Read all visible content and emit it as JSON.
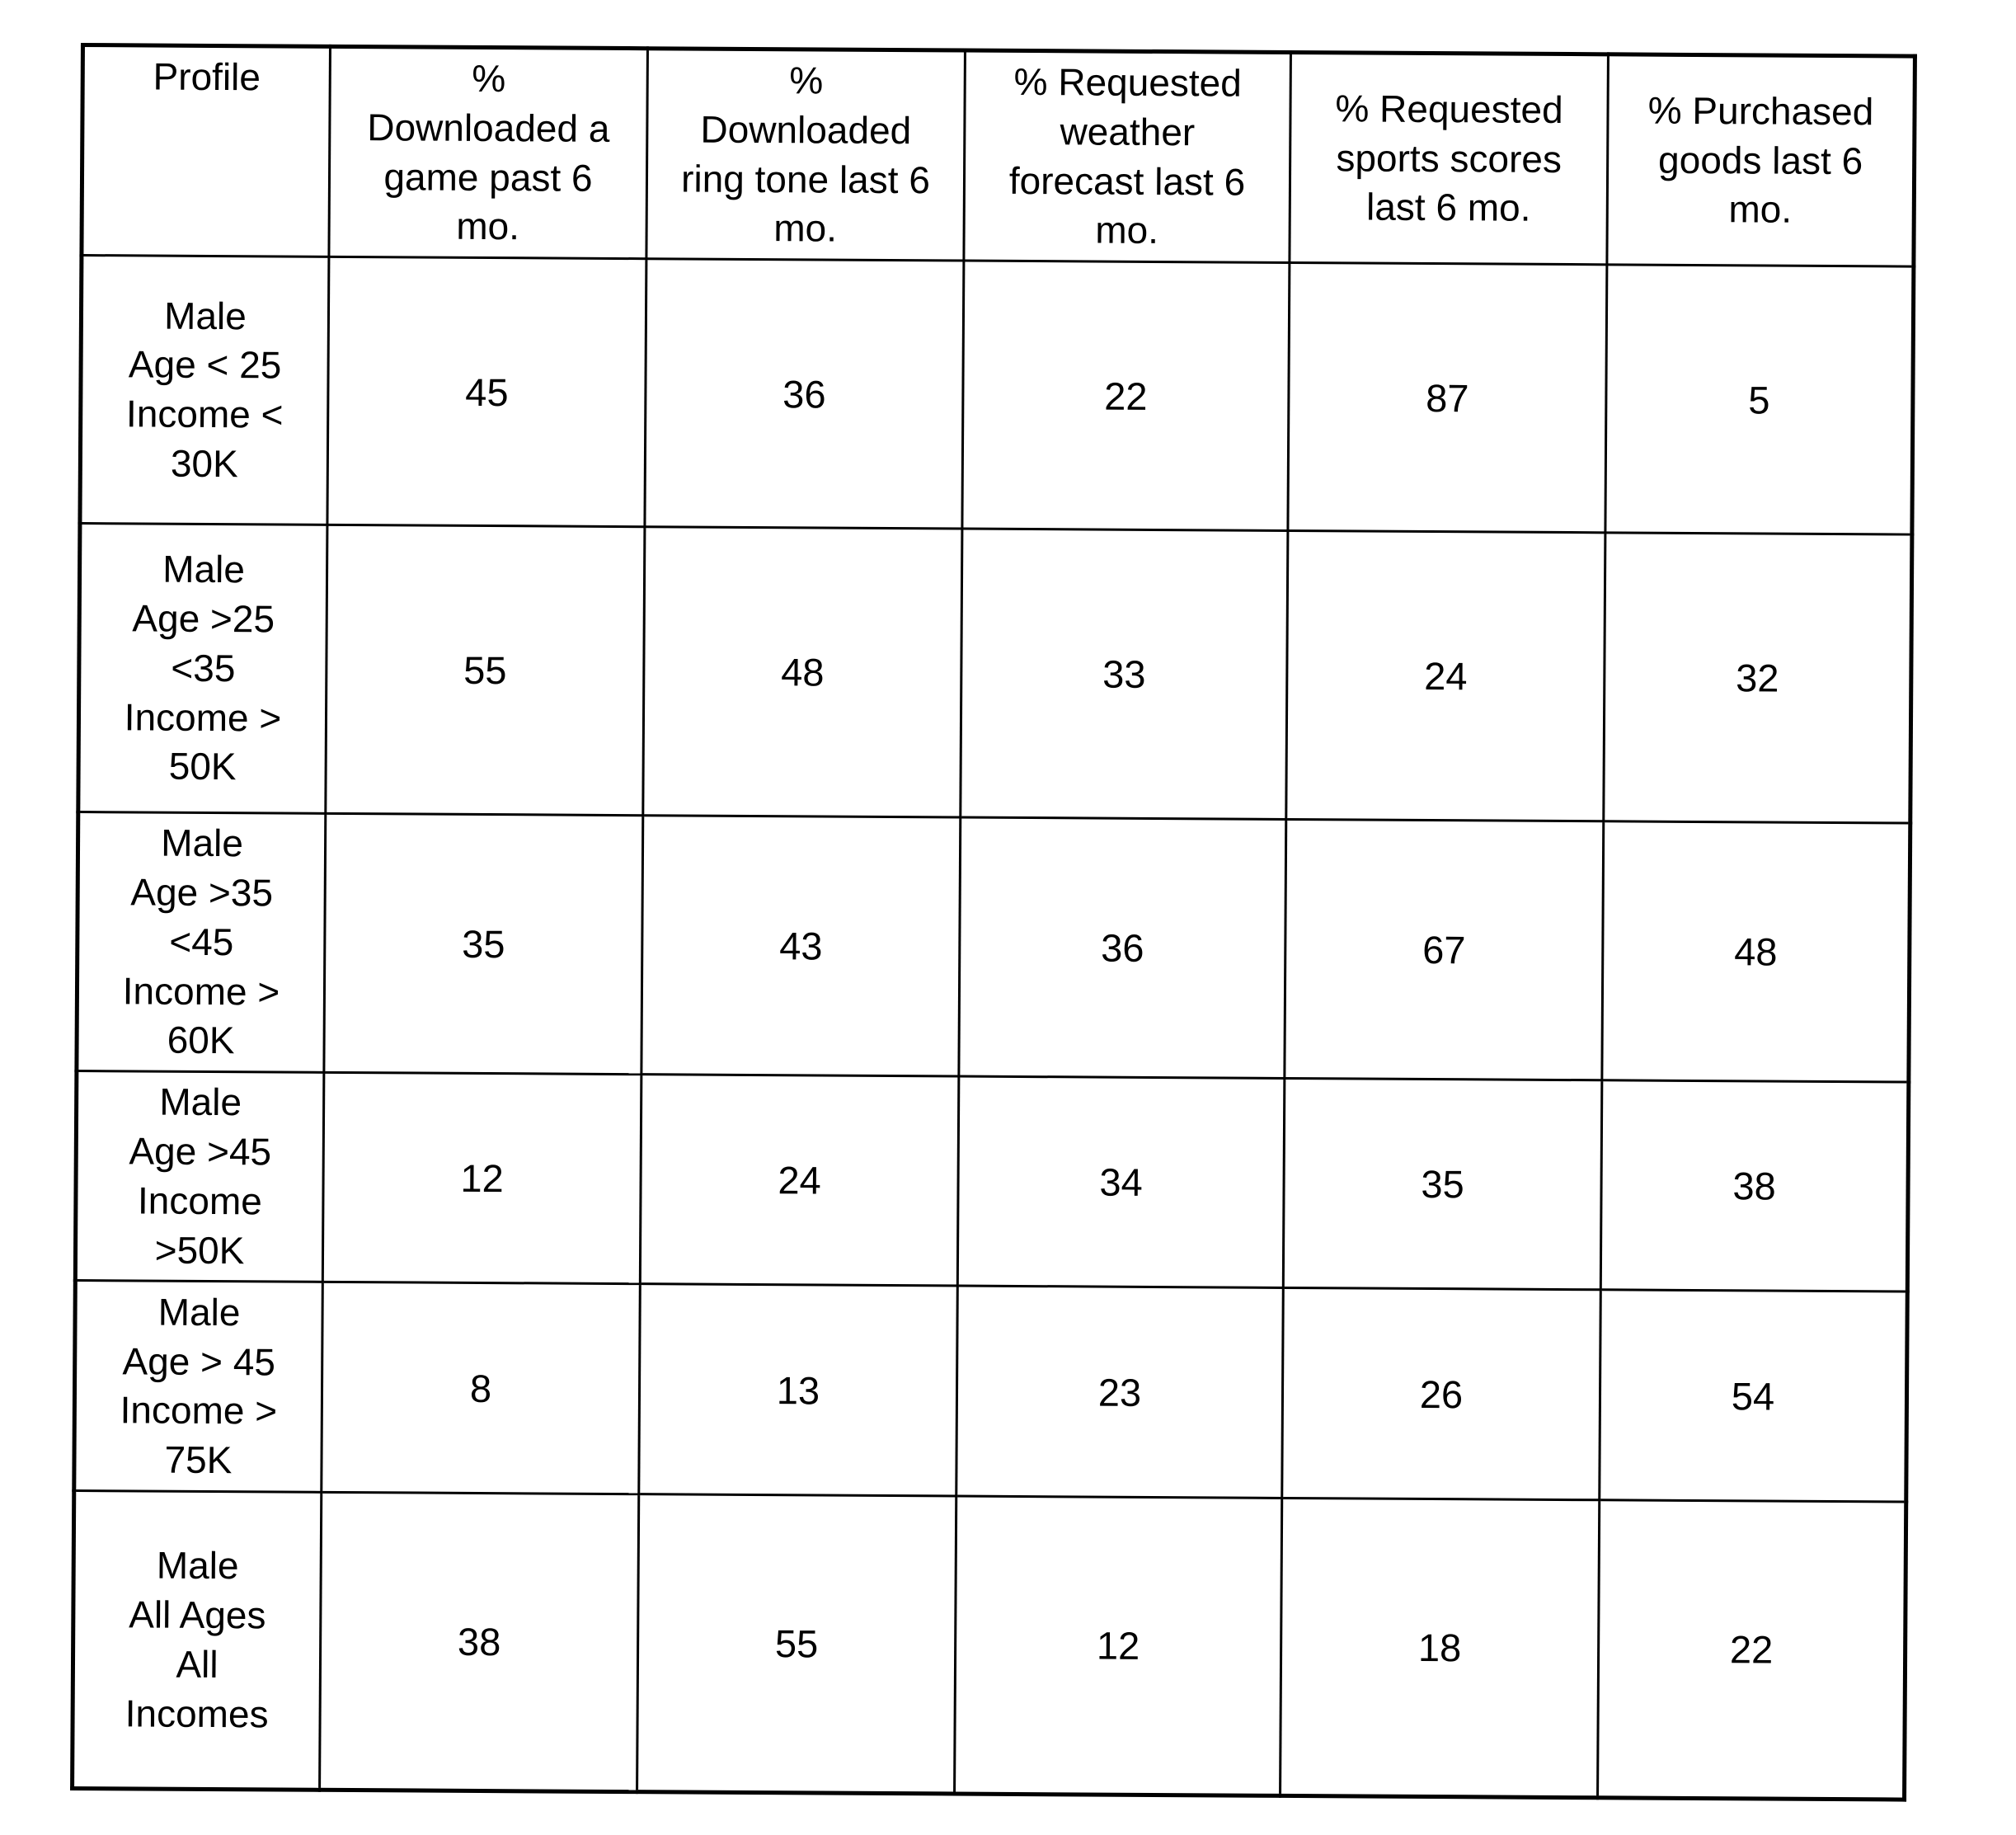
{
  "document": {
    "type": "scanned-table",
    "page_background": "#ffffff",
    "ink_color": "#000000"
  },
  "table": {
    "columns": [
      {
        "key": "profile",
        "label_lines": [
          "Profile"
        ]
      },
      {
        "key": "games",
        "label_lines": [
          "%",
          "Downloaded a",
          "game past 6",
          "mo."
        ]
      },
      {
        "key": "ringtone",
        "label_lines": [
          "%",
          "Downloaded",
          "ring tone last 6",
          "mo."
        ]
      },
      {
        "key": "weather",
        "label_lines": [
          "% Requested",
          "weather",
          "forecast last 6",
          "mo."
        ]
      },
      {
        "key": "sports",
        "label_lines": [
          "% Requested",
          "sports scores",
          "last 6 mo."
        ]
      },
      {
        "key": "goods",
        "label_lines": [
          "% Purchased",
          "goods last 6",
          "mo."
        ]
      }
    ],
    "rows": [
      {
        "profile_lines": [
          "Male",
          "Age < 25",
          "Income <",
          "30K"
        ],
        "values": [
          "45",
          "36",
          "22",
          "87",
          "5"
        ],
        "height_class": "row-h-tall"
      },
      {
        "profile_lines": [
          "Male",
          "Age >25",
          "<35",
          "Income >",
          "50K"
        ],
        "values": [
          "55",
          "48",
          "33",
          "24",
          "32"
        ],
        "height_class": "row-h-tall2"
      },
      {
        "profile_lines": [
          "Male",
          "Age >35",
          "<45",
          "Income >",
          "60K"
        ],
        "values": [
          "35",
          "43",
          "36",
          "67",
          "48"
        ],
        "height_class": "row-h-med"
      },
      {
        "profile_lines": [
          "Male",
          "Age >45",
          "Income",
          ">50K"
        ],
        "values": [
          "12",
          "24",
          "34",
          "35",
          "38"
        ],
        "height_class": "row-h-short"
      },
      {
        "profile_lines": [
          "Male",
          "Age > 45",
          "Income >",
          "75K"
        ],
        "values": [
          "8",
          "13",
          "23",
          "26",
          "54"
        ],
        "height_class": "row-h-short2"
      },
      {
        "profile_lines": [
          "Male",
          "All Ages",
          "All",
          "Incomes"
        ],
        "values": [
          "38",
          "55",
          "12",
          "18",
          "22"
        ],
        "height_class": "row-h-last"
      }
    ]
  },
  "chart_data": {
    "type": "table",
    "title": "",
    "categories": [
      "Male Age < 25 Income < 30K",
      "Male Age >25 <35 Income > 50K",
      "Male Age >35 <45 Income > 60K",
      "Male Age >45 Income >50K",
      "Male Age > 45 Income > 75K",
      "Male All Ages All Incomes"
    ],
    "series": [
      {
        "name": "% Downloaded a game past 6 mo.",
        "values": [
          45,
          55,
          35,
          12,
          8,
          38
        ]
      },
      {
        "name": "% Downloaded ring tone last 6 mo.",
        "values": [
          36,
          48,
          43,
          24,
          13,
          55
        ]
      },
      {
        "name": "% Requested weather forecast last 6 mo.",
        "values": [
          22,
          33,
          36,
          34,
          23,
          12
        ]
      },
      {
        "name": "% Requested sports scores last 6 mo.",
        "values": [
          87,
          24,
          67,
          35,
          26,
          18
        ]
      },
      {
        "name": "% Purchased goods last 6 mo.",
        "values": [
          5,
          32,
          48,
          38,
          54,
          22
        ]
      }
    ],
    "xlabel": "Profile",
    "ylabel": "Percent",
    "ylim": [
      0,
      100
    ],
    "grid": true,
    "legend": "none"
  }
}
